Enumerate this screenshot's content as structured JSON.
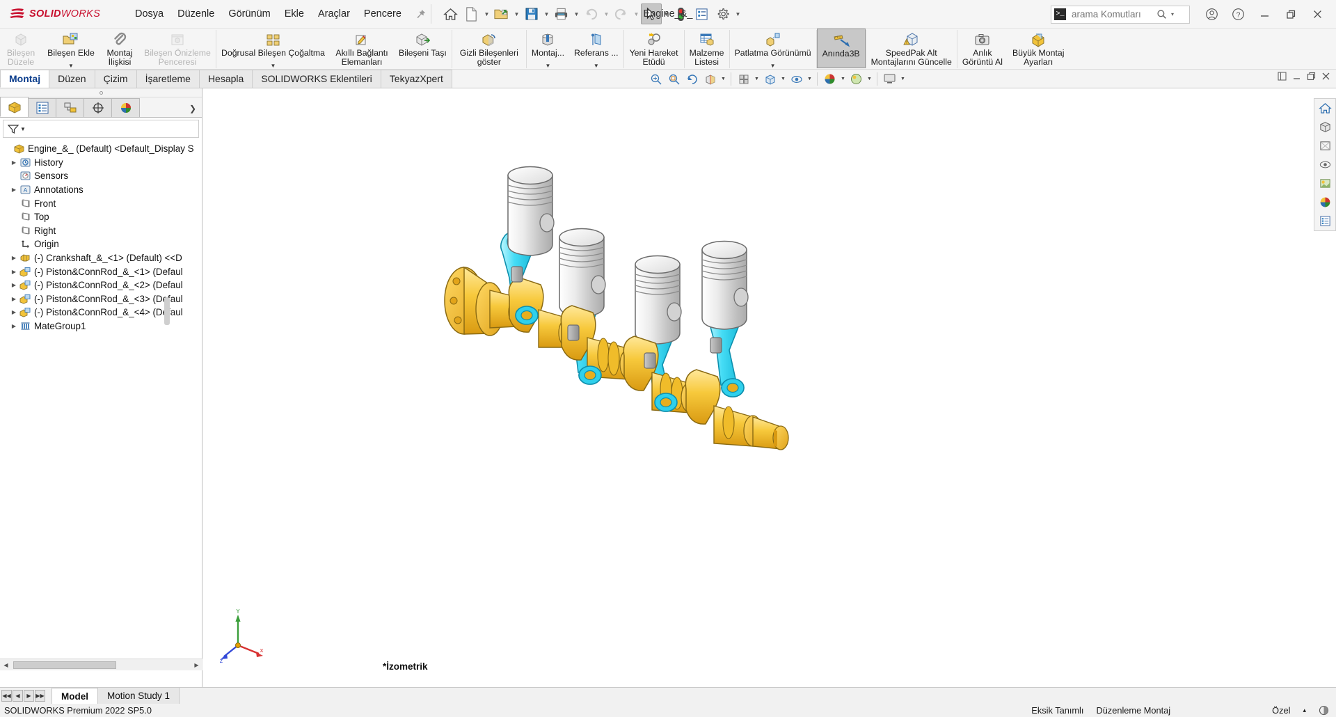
{
  "app": {
    "brand_ds": "ƏS",
    "brand_bold": "SOLID",
    "brand_thin": "WORKS",
    "document_title": "Engine_&_",
    "accent_red": "#c8102e",
    "accent_yellow": "#f2b705",
    "accent_cyan": "#2bd6ef"
  },
  "menubar": {
    "items": [
      {
        "label": "Dosya"
      },
      {
        "label": "Düzenle"
      },
      {
        "label": "Görünüm"
      },
      {
        "label": "Ekle"
      },
      {
        "label": "Araçlar"
      },
      {
        "label": "Pencere"
      }
    ],
    "pin_icon": "pin-icon"
  },
  "quick_access": [
    {
      "name": "home-icon",
      "label": "Ana Sayfa",
      "caret": false,
      "active": false
    },
    {
      "name": "new-document-icon",
      "label": "Yeni",
      "caret": true,
      "active": false
    },
    {
      "name": "open-folder-icon",
      "label": "Aç",
      "caret": true,
      "active": false
    },
    {
      "name": "save-icon",
      "label": "Kaydet",
      "caret": true,
      "active": false
    },
    {
      "name": "print-icon",
      "label": "Yazdır",
      "caret": true,
      "active": false
    },
    {
      "name": "undo-icon",
      "label": "Geri Al",
      "caret": true,
      "active": false,
      "disabled": true
    },
    {
      "name": "redo-icon",
      "label": "Yinele",
      "caret": true,
      "active": false,
      "disabled": true
    },
    {
      "name": "select-cursor-icon",
      "label": "Seç",
      "caret": true,
      "active": true
    },
    {
      "name": "traffic-light-icon",
      "label": "Yeniden Oluştur",
      "caret": false,
      "active": false
    },
    {
      "name": "options-list-icon",
      "label": "Özellikler",
      "caret": false,
      "active": false
    },
    {
      "name": "gear-icon",
      "label": "Seçenekler",
      "caret": true,
      "active": false
    }
  ],
  "search": {
    "placeholder": "arama Komutları",
    "value": "",
    "cmd_glyph": ">_",
    "icon": "search-icon",
    "caret": "▾"
  },
  "window_controls": [
    {
      "name": "account-icon",
      "glyph": "account"
    },
    {
      "name": "help-icon",
      "glyph": "help"
    },
    {
      "name": "minimize-button",
      "glyph": "minimize"
    },
    {
      "name": "restore-button",
      "glyph": "restore"
    },
    {
      "name": "close-button",
      "glyph": "close"
    }
  ],
  "ribbon": {
    "groups": [
      {
        "buttons": [
          {
            "label": "Bileşen\nDüzele",
            "line1": "Bileşen",
            "line2": "Düzele",
            "icon": "edit-component-icon",
            "disabled": true,
            "caret": false
          },
          {
            "label": "Bileşen Ekle",
            "line1": "Bileşen Ekle",
            "line2": "",
            "icon": "insert-component-icon",
            "disabled": false,
            "caret": true
          },
          {
            "label": "Montaj İlişkisi",
            "line1": "Montaj",
            "line2": "İlişkisi",
            "icon": "mate-paperclip-icon",
            "disabled": false,
            "caret": false
          },
          {
            "label": "Bileşen Önizleme Penceresi",
            "line1": "Bileşen Önizleme",
            "line2": "Penceresi",
            "icon": "component-preview-window-icon",
            "disabled": true,
            "caret": false
          }
        ]
      },
      {
        "buttons": [
          {
            "label": "Doğrusal Bileşen Çoğaltma",
            "line1": "Doğrusal Bileşen Çoğaltma",
            "line2": "",
            "icon": "linear-component-pattern-icon",
            "disabled": false,
            "caret": true
          },
          {
            "label": "Akıllı Bağlantı Elemanları",
            "line1": "Akıllı Bağlantı",
            "line2": "Elemanları",
            "icon": "smart-fasteners-icon",
            "disabled": false,
            "caret": false
          },
          {
            "label": "Bileşeni Taşı",
            "line1": "Bileşeni Taşı",
            "line2": "",
            "icon": "move-component-icon",
            "disabled": false,
            "caret": false
          }
        ]
      },
      {
        "buttons": [
          {
            "label": "Gizli Bileşenleri göster",
            "line1": "Gizli Bileşenleri",
            "line2": "göster",
            "icon": "show-hidden-components-icon",
            "disabled": false,
            "caret": false
          }
        ]
      },
      {
        "buttons": [
          {
            "label": "Montaj...",
            "line1": "Montaj...",
            "line2": "",
            "icon": "assembly-features-icon",
            "disabled": false,
            "caret": true
          },
          {
            "label": "Referans ...",
            "line1": "Referans ...",
            "line2": "",
            "icon": "reference-geometry-icon",
            "disabled": false,
            "caret": true
          }
        ]
      },
      {
        "buttons": [
          {
            "label": "Yeni Hareket Etüdü",
            "line1": "Yeni Hareket",
            "line2": "Etüdü",
            "icon": "new-motion-study-icon",
            "disabled": false,
            "caret": false
          }
        ]
      },
      {
        "buttons": [
          {
            "label": "Malzeme Listesi",
            "line1": "Malzeme",
            "line2": "Listesi",
            "icon": "bill-of-materials-icon",
            "disabled": false,
            "caret": false
          }
        ]
      },
      {
        "buttons": [
          {
            "label": "Patlatma Görünümü",
            "line1": "Patlatma Görünümü",
            "line2": "",
            "icon": "exploded-view-icon",
            "disabled": false,
            "caret": true
          }
        ]
      },
      {
        "buttons": [
          {
            "label": "Anında3B",
            "line1": "Anında3B",
            "line2": "",
            "icon": "instant3d-icon",
            "disabled": false,
            "caret": false,
            "pressed": true
          }
        ]
      },
      {
        "buttons": [
          {
            "label": "SpeedPak Alt Montajlarını Güncelle",
            "line1": "SpeedPak Alt",
            "line2": "Montajlarını Güncelle",
            "icon": "update-speedpak-icon",
            "disabled": false,
            "caret": false
          }
        ]
      },
      {
        "buttons": [
          {
            "label": "Anlık Görüntü Al",
            "line1": "Anlık",
            "line2": "Görüntü Al",
            "icon": "take-snapshot-camera-icon",
            "disabled": false,
            "caret": false
          },
          {
            "label": "Büyük Montaj Ayarları",
            "line1": "Büyük Montaj",
            "line2": "Ayarları",
            "icon": "large-assembly-settings-icon",
            "disabled": false,
            "caret": false
          }
        ]
      }
    ]
  },
  "command_tabs": [
    {
      "label": "Montaj",
      "active": true
    },
    {
      "label": "Düzen",
      "active": false
    },
    {
      "label": "Çizim",
      "active": false
    },
    {
      "label": "İşaretleme",
      "active": false
    },
    {
      "label": "Hesapla",
      "active": false
    },
    {
      "label": "SOLIDWORKS Eklentileri",
      "active": false
    },
    {
      "label": "TekyazXpert",
      "active": false
    }
  ],
  "view_toolbar": [
    {
      "name": "zoom-to-fit-icon",
      "caret": false
    },
    {
      "name": "zoom-to-area-icon",
      "caret": false
    },
    {
      "name": "previous-view-icon",
      "caret": false
    },
    {
      "name": "section-view-icon",
      "caret": false
    },
    {
      "name": "view-orientation-icon",
      "caret": true
    },
    {
      "name": "display-style-icon",
      "caret": true
    },
    {
      "name": "hide-show-items-icon",
      "caret": true
    },
    {
      "name": "edit-appearance-icon",
      "caret": true
    },
    {
      "name": "apply-scene-icon",
      "caret": true
    },
    {
      "name": "view-settings-icon",
      "caret": true
    }
  ],
  "mdi_controls": [
    {
      "name": "tile-windows-icon"
    },
    {
      "name": "minimize-document-icon"
    },
    {
      "name": "restore-document-icon"
    },
    {
      "name": "close-document-icon"
    }
  ],
  "left_panel": {
    "tabs": [
      {
        "name": "feature-manager-tab",
        "icon": "feature-tree-icon",
        "active": true
      },
      {
        "name": "property-manager-tab",
        "icon": "property-manager-icon",
        "active": false
      },
      {
        "name": "configuration-manager-tab",
        "icon": "configuration-manager-icon",
        "active": false
      },
      {
        "name": "dimxpert-manager-tab",
        "icon": "dimxpert-icon",
        "active": false
      },
      {
        "name": "display-manager-tab",
        "icon": "display-manager-icon",
        "active": false
      }
    ],
    "expand_glyph": "❯",
    "filter": {
      "placeholder": "",
      "value": "",
      "icon": "filter-funnel-icon"
    },
    "tree": [
      {
        "label": "Engine_&_ (Default) <Default_Display S",
        "icon": "assembly-icon",
        "indent": 0,
        "expandable": false,
        "root": true
      },
      {
        "label": "History",
        "icon": "history-icon",
        "indent": 1,
        "expandable": true
      },
      {
        "label": "Sensors",
        "icon": "sensors-icon",
        "indent": 1,
        "expandable": false
      },
      {
        "label": "Annotations",
        "icon": "annotations-icon",
        "indent": 1,
        "expandable": true
      },
      {
        "label": "Front",
        "icon": "plane-icon",
        "indent": 1,
        "expandable": false
      },
      {
        "label": "Top",
        "icon": "plane-icon",
        "indent": 1,
        "expandable": false
      },
      {
        "label": "Right",
        "icon": "plane-icon",
        "indent": 1,
        "expandable": false
      },
      {
        "label": "Origin",
        "icon": "origin-icon",
        "indent": 1,
        "expandable": false
      },
      {
        "label": "(-) Crankshaft_&_<1> (Default) <<D",
        "icon": "part-icon",
        "indent": 1,
        "expandable": true
      },
      {
        "label": "(-) Piston&ConnRod_&_<1> (Defaul",
        "icon": "subassembly-icon",
        "indent": 1,
        "expandable": true
      },
      {
        "label": "(-) Piston&ConnRod_&_<2> (Defaul",
        "icon": "subassembly-icon",
        "indent": 1,
        "expandable": true
      },
      {
        "label": "(-) Piston&ConnRod_&_<3> (Defaul",
        "icon": "subassembly-icon",
        "indent": 1,
        "expandable": true
      },
      {
        "label": "(-) Piston&ConnRod_&_<4> (Defaul",
        "icon": "subassembly-icon",
        "indent": 1,
        "expandable": true
      },
      {
        "label": "MateGroup1",
        "icon": "mategroup-icon",
        "indent": 1,
        "expandable": true
      }
    ]
  },
  "graphics": {
    "view_label": "*İzometrik",
    "triad": {
      "x": "x",
      "y": "Y",
      "z": "z",
      "x_color": "#d83232",
      "y_color": "#3a9e3a",
      "z_color": "#3248d8"
    },
    "model": {
      "name": "Engine assembly — crankshaft with 4 piston & connecting rod sets",
      "crankshaft_color": "#f5c23a",
      "conrod_color": "#4fe1f5",
      "piston_color": "#dcdcdc"
    },
    "right_toolbar": [
      {
        "name": "home-view-icon"
      },
      {
        "name": "view-orientation-icon"
      },
      {
        "name": "display-style-icon"
      },
      {
        "name": "hide-show-icon"
      },
      {
        "name": "apply-scene-icon"
      },
      {
        "name": "appearance-icon"
      },
      {
        "name": "display-manager-icon"
      }
    ]
  },
  "bottom": {
    "nav_buttons": [
      {
        "name": "first-study-button",
        "glyph": "◀◀"
      },
      {
        "name": "previous-study-button",
        "glyph": "◀"
      },
      {
        "name": "next-study-button",
        "glyph": "▶"
      },
      {
        "name": "last-study-button",
        "glyph": "▶▶"
      }
    ],
    "tabs": [
      {
        "label": "Model",
        "active": true
      },
      {
        "label": "Motion Study 1",
        "active": false
      }
    ]
  },
  "status_bar": {
    "left": "SOLIDWORKS Premium 2022 SP5.0",
    "items": [
      {
        "label": "Eksik Tanımlı"
      },
      {
        "label": "Düzenleme Montaj"
      }
    ],
    "right_label": "Özel",
    "right_caret": "▴",
    "right_icon": "display-state-icon"
  }
}
